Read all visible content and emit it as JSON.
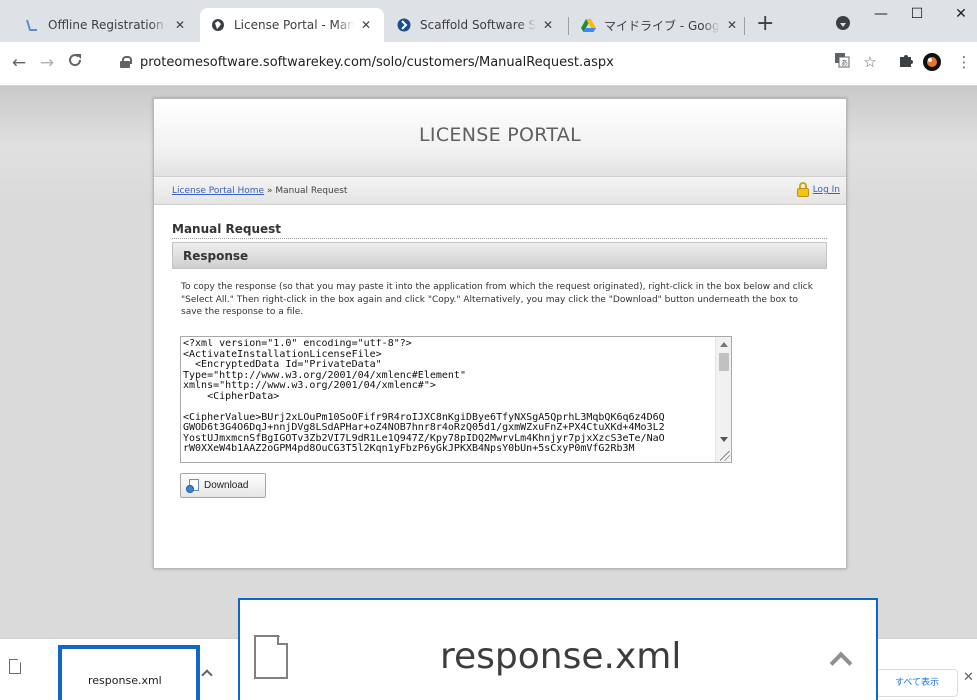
{
  "browser": {
    "tabs": [
      {
        "title": "Offline Registration for S",
        "icon": "app-icon",
        "active": false
      },
      {
        "title": "License Portal - Manual ",
        "icon": "globe-icon",
        "active": true
      },
      {
        "title": "Scaffold Software Solutio",
        "icon": "app-icon",
        "active": false
      },
      {
        "title": "マイドライブ - Google ドライ",
        "icon": "google-drive-icon",
        "active": false
      }
    ],
    "new_tab": "+",
    "url": "proteomesoftware.softwarekey.com/solo/customers/ManualRequest.aspx",
    "window_controls": {
      "minimize": "—",
      "maximize": "☐",
      "close": "✕"
    }
  },
  "page": {
    "header_title": "LICENSE PORTAL",
    "breadcrumb": {
      "home_link": "License Portal Home",
      "separator": " » ",
      "current": "Manual Request"
    },
    "login_link": "Log In",
    "section_title": "Manual Request",
    "response_heading": "Response",
    "instructions": "To copy the response (so that you may paste it into the application from which the request originated), right-click in the box below and click \"Select All.\" Then right-click in the box again and click \"Copy.\" Alternatively, you may click the \"Download\" button underneath the box to save the response to a file.",
    "response_text": "<?xml version=\"1.0\" encoding=\"utf-8\"?>\n<ActivateInstallationLicenseFile>\n  <EncryptedData Id=\"PrivateData\"\nType=\"http://www.w3.org/2001/04/xmlenc#Element\"\nxmlns=\"http://www.w3.org/2001/04/xmlenc#\">\n    <CipherData>\n\n<CipherValue>BUrj2xLOuPm10SoOFifr9R4roIJXC8nKgiDBye6TfyNXSgA5QprhL3MqbQK6q6z4D6Q\nGWOD6t3G4O6DqJ+nnjDVg8LSdAPHar+oZ4NOB7hnr8r4oRzQ05d1/gxmWZxuFnZ+PX4CtuXKd+4Mo3L2\nYostUJmxmcnSfBgIGOTv3Zb2VI7L9dR1Le1Q947Z/Kpy78pIDQ2MwrvLm4Khnjyr7pjxXzcS3eTe/NaO\nrW0XXeW4b1AAZ2oGPM4pd8OuCG3T5l2Kqn1yFbzP6yGkJPKXB4NpsY0bUn+5sCxyP0mVfG2Rb3M",
    "download_button": "Download"
  },
  "downloads": {
    "file_name": "response.xml",
    "show_all": "すべて表示",
    "close": "✕"
  }
}
